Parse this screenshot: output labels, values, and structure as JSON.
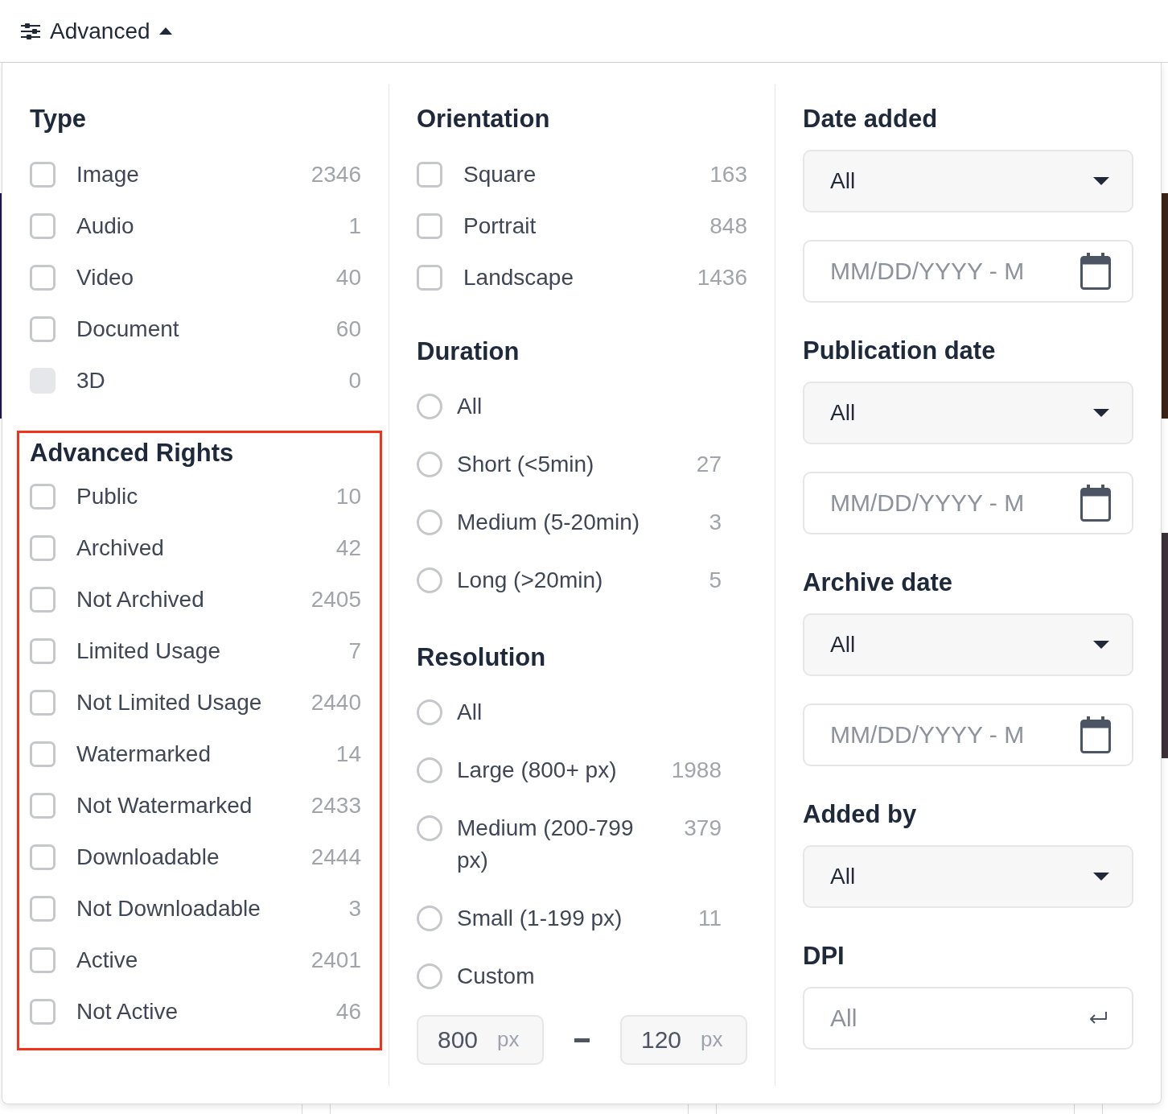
{
  "toolbar": {
    "label": "Advanced",
    "expanded": true
  },
  "columns": [
    {
      "sections": [
        {
          "kind": "checkboxes",
          "title": "Type",
          "highlighted": false,
          "options": [
            {
              "label": "Image",
              "count": "2346",
              "checked": false,
              "disabled": false
            },
            {
              "label": "Audio",
              "count": "1",
              "checked": false,
              "disabled": false
            },
            {
              "label": "Video",
              "count": "40",
              "checked": false,
              "disabled": false
            },
            {
              "label": "Document",
              "count": "60",
              "checked": false,
              "disabled": false
            },
            {
              "label": "3D",
              "count": "0",
              "checked": false,
              "disabled": true
            }
          ]
        },
        {
          "kind": "checkboxes",
          "title": "Advanced Rights",
          "highlighted": true,
          "options": [
            {
              "label": "Public",
              "count": "10",
              "checked": false,
              "disabled": false
            },
            {
              "label": "Archived",
              "count": "42",
              "checked": false,
              "disabled": false
            },
            {
              "label": "Not Archived",
              "count": "2405",
              "checked": false,
              "disabled": false
            },
            {
              "label": "Limited Usage",
              "count": "7",
              "checked": false,
              "disabled": false
            },
            {
              "label": "Not Limited Usage",
              "count": "2440",
              "checked": false,
              "disabled": false
            },
            {
              "label": "Watermarked",
              "count": "14",
              "checked": false,
              "disabled": false
            },
            {
              "label": "Not Watermarked",
              "count": "2433",
              "checked": false,
              "disabled": false
            },
            {
              "label": "Downloadable",
              "count": "2444",
              "checked": false,
              "disabled": false
            },
            {
              "label": "Not Downloadable",
              "count": "3",
              "checked": false,
              "disabled": false
            },
            {
              "label": "Active",
              "count": "2401",
              "checked": false,
              "disabled": false
            },
            {
              "label": "Not Active",
              "count": "46",
              "checked": false,
              "disabled": false
            }
          ]
        }
      ]
    },
    {
      "sections": [
        {
          "kind": "checkboxes",
          "title": "Orientation",
          "highlighted": false,
          "options": [
            {
              "label": "Square",
              "count": "163",
              "checked": false,
              "disabled": false
            },
            {
              "label": "Portrait",
              "count": "848",
              "checked": false,
              "disabled": false
            },
            {
              "label": "Landscape",
              "count": "1436",
              "checked": false,
              "disabled": false
            }
          ]
        },
        {
          "kind": "radios",
          "title": "Duration",
          "options": [
            {
              "label": "All",
              "selected": false
            },
            {
              "label": "Short (<5min)",
              "count": "27",
              "selected": false
            },
            {
              "label": "Medium (5-20min)",
              "count": "3",
              "selected": false
            },
            {
              "label": "Long (>20min)",
              "count": "5",
              "selected": false
            }
          ]
        },
        {
          "kind": "radios",
          "title": "Resolution",
          "options": [
            {
              "label": "All",
              "selected": false
            },
            {
              "label": "Large (800+ px)",
              "count": "1988",
              "selected": false
            },
            {
              "label": "Medium (200-799 px)",
              "count": "379",
              "selected": false
            },
            {
              "label": "Small (1-199 px)",
              "count": "11",
              "selected": false
            },
            {
              "label": "Custom",
              "selected": false
            }
          ],
          "range": {
            "min": {
              "value": "800",
              "unit": "px"
            },
            "max": {
              "value": "120",
              "unit": "px"
            }
          }
        }
      ]
    },
    {
      "sections": [
        {
          "kind": "date",
          "title": "Date added",
          "select": {
            "value": "All"
          },
          "range": {
            "placeholder": "MM/DD/YYYY - M"
          }
        },
        {
          "kind": "date",
          "title": "Publication date",
          "select": {
            "value": "All"
          },
          "range": {
            "placeholder": "MM/DD/YYYY - M"
          }
        },
        {
          "kind": "date",
          "title": "Archive date",
          "select": {
            "value": "All"
          },
          "range": {
            "placeholder": "MM/DD/YYYY - M"
          }
        },
        {
          "kind": "select",
          "title": "Added by",
          "select": {
            "value": "All"
          }
        },
        {
          "kind": "input",
          "title": "DPI",
          "field": {
            "placeholder": "All"
          }
        }
      ]
    }
  ]
}
